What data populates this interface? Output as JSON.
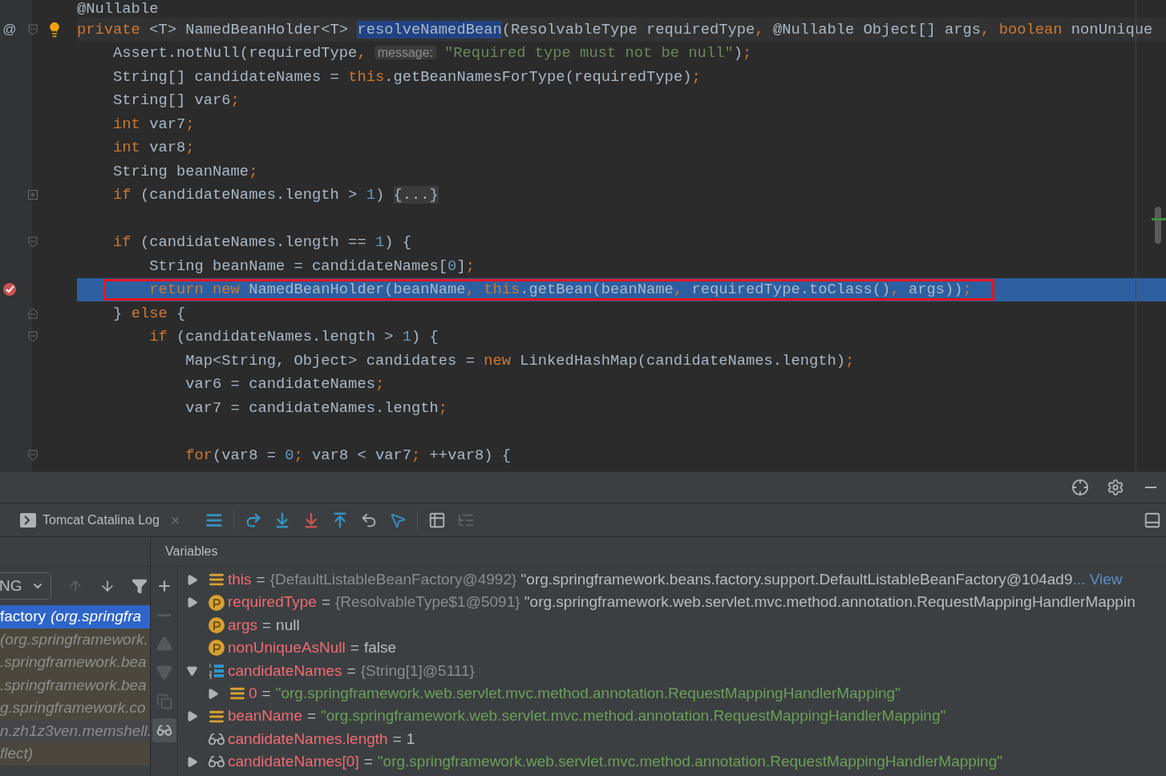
{
  "editor": {
    "lines": [
      {
        "tokens": [
          {
            "kind": "p",
            "t": "@Nullable"
          }
        ]
      },
      {
        "gutter": [
          {
            "kind": "at",
            "text": "@"
          },
          {
            "kind": "fold"
          },
          {
            "kind": "bulb"
          }
        ],
        "caret_row": true,
        "tokens": [
          {
            "kind": "k",
            "t": "private"
          },
          {
            "kind": "p",
            "t": " <T> NamedBeanHolder<T> "
          },
          {
            "kind": "sel",
            "t": "resolveNamedBean"
          },
          {
            "kind": "p",
            "t": "(ResolvableType requiredType"
          },
          {
            "kind": "k",
            "t": ","
          },
          {
            "kind": "p",
            "t": " @Nullable Object[] args"
          },
          {
            "kind": "k",
            "t": ", boolean"
          },
          {
            "kind": "p",
            "t": " nonUnique"
          }
        ]
      },
      {
        "tokens": [
          {
            "kind": "p",
            "t": "    Assert.notNull(requiredType"
          },
          {
            "kind": "k",
            "t": ","
          },
          {
            "kind": "h",
            "t": "message:"
          },
          {
            "kind": "s",
            "t": "\"Required type must not be null\""
          },
          {
            "kind": "p",
            "t": ")"
          },
          {
            "kind": "k",
            "t": ";"
          }
        ]
      },
      {
        "tokens": [
          {
            "kind": "p",
            "t": "    String[] candidateNames = "
          },
          {
            "kind": "k",
            "t": "this"
          },
          {
            "kind": "p",
            "t": ".getBeanNamesForType(requiredType)"
          },
          {
            "kind": "k",
            "t": ";"
          }
        ]
      },
      {
        "tokens": [
          {
            "kind": "p",
            "t": "    String[] var6"
          },
          {
            "kind": "k",
            "t": ";"
          }
        ]
      },
      {
        "tokens": [
          {
            "kind": "k",
            "t": "    int"
          },
          {
            "kind": "p",
            "t": " var7"
          },
          {
            "kind": "k",
            "t": ";"
          }
        ]
      },
      {
        "tokens": [
          {
            "kind": "k",
            "t": "    int"
          },
          {
            "kind": "p",
            "t": " var8"
          },
          {
            "kind": "k",
            "t": ";"
          }
        ]
      },
      {
        "tokens": [
          {
            "kind": "p",
            "t": "    String beanName"
          },
          {
            "kind": "k",
            "t": ";"
          }
        ]
      },
      {
        "gutter": [
          {
            "kind": "unfold"
          }
        ],
        "tokens": [
          {
            "kind": "k",
            "t": "    if"
          },
          {
            "kind": "p",
            "t": " (candidateNames.length > "
          },
          {
            "kind": "n",
            "t": "1"
          },
          {
            "kind": "p",
            "t": ") "
          },
          {
            "kind": "f",
            "t": "{...}"
          }
        ]
      },
      {
        "gap_before": true,
        "gutter": [
          {
            "kind": "fold"
          }
        ],
        "tokens": [
          {
            "kind": "k",
            "t": "    if"
          },
          {
            "kind": "p",
            "t": " (candidateNames.length == "
          },
          {
            "kind": "n",
            "t": "1"
          },
          {
            "kind": "p",
            "t": ") {"
          }
        ]
      },
      {
        "tokens": [
          {
            "kind": "p",
            "t": "        String beanName = candidateNames["
          },
          {
            "kind": "n",
            "t": "0"
          },
          {
            "kind": "p",
            "t": "]"
          },
          {
            "kind": "k",
            "t": ";"
          }
        ]
      },
      {
        "gutter": [
          {
            "kind": "breakpoint"
          }
        ],
        "current": true,
        "boxed": true,
        "tokens": [
          {
            "kind": "k",
            "t": "        return new"
          },
          {
            "kind": "p",
            "t": " NamedBeanHolder(beanName"
          },
          {
            "kind": "k",
            "t": ", this"
          },
          {
            "kind": "p",
            "t": ".getBean(beanName"
          },
          {
            "kind": "k",
            "t": ","
          },
          {
            "kind": "p",
            "t": " requiredType.toClass()"
          },
          {
            "kind": "k",
            "t": ","
          },
          {
            "kind": "p",
            "t": " args))"
          },
          {
            "kind": "k",
            "t": ";"
          }
        ]
      },
      {
        "gutter": [
          {
            "kind": "foldend"
          }
        ],
        "tokens": [
          {
            "kind": "p",
            "t": "    } "
          },
          {
            "kind": "k",
            "t": "else"
          },
          {
            "kind": "p",
            "t": " {"
          }
        ]
      },
      {
        "gutter": [
          {
            "kind": "fold"
          }
        ],
        "tokens": [
          {
            "kind": "k",
            "t": "        if"
          },
          {
            "kind": "p",
            "t": " (candidateNames.length > "
          },
          {
            "kind": "n",
            "t": "1"
          },
          {
            "kind": "p",
            "t": ") {"
          }
        ]
      },
      {
        "tokens": [
          {
            "kind": "p",
            "t": "            Map<String, Object> candidates = "
          },
          {
            "kind": "k",
            "t": "new"
          },
          {
            "kind": "p",
            "t": " LinkedHashMap(candidateNames.length)"
          },
          {
            "kind": "k",
            "t": ";"
          }
        ]
      },
      {
        "tokens": [
          {
            "kind": "p",
            "t": "            var6 = candidateNames"
          },
          {
            "kind": "k",
            "t": ";"
          }
        ]
      },
      {
        "tokens": [
          {
            "kind": "p",
            "t": "            var7 = candidateNames.length"
          },
          {
            "kind": "k",
            "t": ";"
          }
        ]
      },
      {
        "gap_before": true,
        "gutter": [
          {
            "kind": "fold"
          }
        ],
        "tokens": [
          {
            "kind": "k",
            "t": "            for"
          },
          {
            "kind": "p",
            "t": "(var8 = "
          },
          {
            "kind": "n",
            "t": "0"
          },
          {
            "kind": "k",
            "t": ";"
          },
          {
            "kind": "p",
            "t": " var8 < var7"
          },
          {
            "kind": "k",
            "t": ";"
          },
          {
            "kind": "p",
            "t": " ++var8) {"
          }
        ]
      }
    ]
  },
  "panel_actions": [
    {
      "kind": "crosshair"
    },
    {
      "kind": "settings"
    },
    {
      "kind": "minimize"
    }
  ],
  "debug_toolbar": {
    "tab": {
      "label": "Tomcat Catalina Log",
      "close": "×"
    },
    "buttons": [
      {
        "kind": "frames",
        "disabled": false
      },
      {
        "kind": "step_over",
        "disabled": false
      },
      {
        "kind": "step_into",
        "disabled": false
      },
      {
        "kind": "force_step_into",
        "disabled": false
      },
      {
        "kind": "step_out",
        "disabled": false
      },
      {
        "kind": "drop_frame",
        "disabled": false
      },
      {
        "kind": "run_to_cursor",
        "disabled": false
      },
      {
        "kind": "evaluate",
        "disabled": false
      },
      {
        "kind": "trace",
        "disabled": true
      }
    ]
  },
  "frames": {
    "thread": "NG",
    "nav": [
      {
        "kind": "up",
        "disabled": true
      },
      {
        "kind": "down",
        "disabled": false
      },
      {
        "kind": "filter",
        "disabled": false
      }
    ],
    "items": [
      {
        "method": "factory",
        "text": "(org.springfra",
        "selected": true
      },
      {
        "text": "(org.springframework.",
        "selected": false,
        "library": true
      },
      {
        "text": ".springframework.bea",
        "selected": false,
        "library": true
      },
      {
        "text": ".springframework.bea",
        "selected": false,
        "library": true
      },
      {
        "text": "g.springframework.co",
        "selected": false,
        "library": true
      },
      {
        "text": "n.zh1z3ven.memshell.",
        "selected": false,
        "library": false
      },
      {
        "text": "flect)",
        "selected": false,
        "library": true
      }
    ]
  },
  "variables": {
    "title": "Variables",
    "side_tools": [
      {
        "kind": "add",
        "disabled": false,
        "selected": false
      },
      {
        "kind": "remove",
        "disabled": true,
        "selected": false
      },
      {
        "kind": "up",
        "disabled": true,
        "selected": false
      },
      {
        "kind": "down",
        "disabled": true,
        "selected": false
      },
      {
        "kind": "copy",
        "disabled": true,
        "selected": false
      },
      {
        "kind": "watches",
        "disabled": false,
        "selected": true
      }
    ],
    "items": [
      {
        "name": "this",
        "kind": "field",
        "expanded": false,
        "equals": "=",
        "value": [
          {
            "kind": "ref",
            "t": "{DefaultListableBeanFactory@4992}"
          },
          {
            "kind": "plain",
            "t": " \"org.springframework.beans.factory.support.DefaultListableBeanFactory@104ad9"
          },
          {
            "kind": "link",
            "t": "... View"
          }
        ]
      },
      {
        "name": "requiredType",
        "kind": "param",
        "expanded": false,
        "equals": "=",
        "value": [
          {
            "kind": "ref",
            "t": "{ResolvableType$1@5091}"
          },
          {
            "kind": "plain",
            "t": " \"org.springframework.web.servlet.mvc.method.annotation.RequestMappingHandlerMappin"
          }
        ]
      },
      {
        "name": "args",
        "kind": "param",
        "equals": "=",
        "value": [
          {
            "kind": "plain",
            "t": "null"
          }
        ]
      },
      {
        "name": "nonUniqueAsNull",
        "kind": "param",
        "equals": "=",
        "value": [
          {
            "kind": "plain",
            "t": "false"
          }
        ]
      },
      {
        "name": "candidateNames",
        "kind": "array",
        "expanded": true,
        "equals": "=",
        "value": [
          {
            "kind": "ref",
            "t": "{String[1]@5111}"
          }
        ],
        "children": [
          {
            "name": "0",
            "kind": "field",
            "expanded": false,
            "equals": "=",
            "value": [
              {
                "kind": "str",
                "t": "\"org.springframework.web.servlet.mvc.method.annotation.RequestMappingHandlerMapping\""
              }
            ]
          }
        ]
      },
      {
        "name": "beanName",
        "kind": "field",
        "expanded": false,
        "equals": "=",
        "value": [
          {
            "kind": "str",
            "t": "\"org.springframework.web.servlet.mvc.method.annotation.RequestMappingHandlerMapping\""
          }
        ]
      },
      {
        "name": "candidateNames.length",
        "kind": "watch",
        "equals": "=",
        "value": [
          {
            "kind": "plain",
            "t": "1"
          }
        ]
      },
      {
        "name": "candidateNames[0]",
        "kind": "watch",
        "expanded": false,
        "equals": "=",
        "value": [
          {
            "kind": "str",
            "t": "\"org.springframework.web.servlet.mvc.method.annotation.RequestMappingHandlerMapping\""
          }
        ]
      }
    ]
  }
}
